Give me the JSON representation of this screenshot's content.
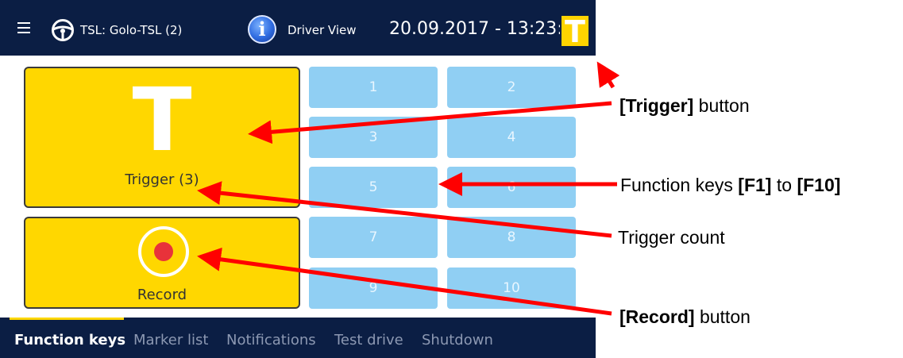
{
  "header": {
    "tsl_label": "TSL: Golo-TSL (2)",
    "view_label": "Driver View",
    "datetime": "20.09.2017 - 13:23:40",
    "badge_letter": "T"
  },
  "trigger": {
    "letter": "T",
    "count_label": "Trigger (3)"
  },
  "record": {
    "label": "Record"
  },
  "function_keys": [
    "1",
    "2",
    "3",
    "4",
    "5",
    "6",
    "7",
    "8",
    "9",
    "10"
  ],
  "tabs": [
    {
      "label": "Function keys",
      "active": true
    },
    {
      "label": "Marker list",
      "active": false
    },
    {
      "label": "Notifications",
      "active": false
    },
    {
      "label": "Test drive",
      "active": false
    },
    {
      "label": "Shutdown",
      "active": false
    }
  ],
  "annotations": {
    "trigger_button": {
      "bold": "[Trigger]",
      "rest": " button"
    },
    "function_keys": {
      "pre": "Function keys ",
      "b1": "[F1]",
      "mid": " to ",
      "b2": "[F10]"
    },
    "trigger_count": "Trigger count",
    "record_button": {
      "bold": "[Record]",
      "rest": " button"
    }
  },
  "colors": {
    "header_bg": "#0b1e44",
    "button_yellow": "#ffd700",
    "fkey_blue": "#90cff3",
    "record_red": "#e8323a",
    "arrow_red": "#ff0000"
  },
  "icons": [
    "hamburger-icon",
    "steering-wheel-icon",
    "info-icon",
    "record-icon"
  ]
}
